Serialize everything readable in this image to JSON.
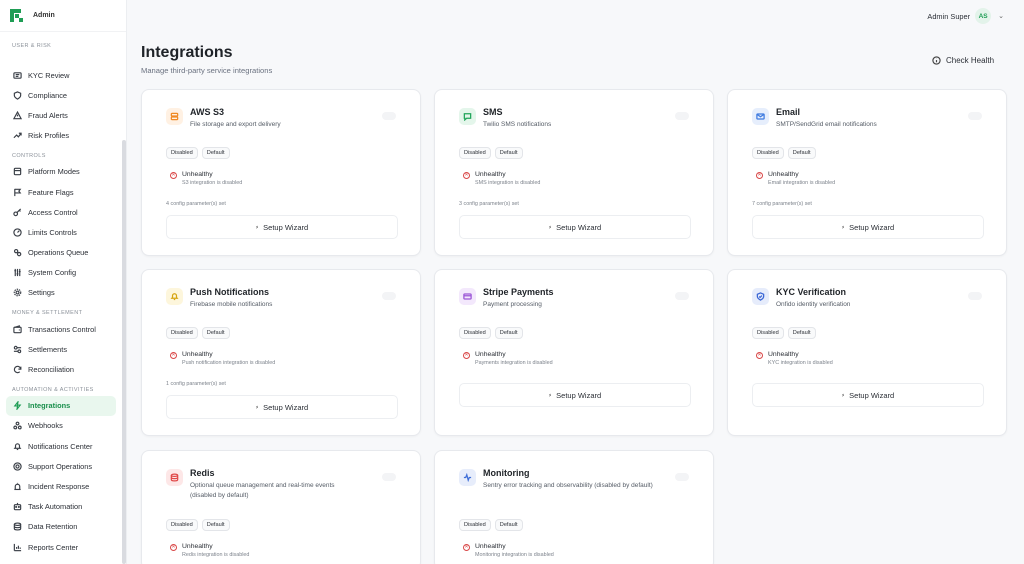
{
  "brand": {
    "name": "Admin"
  },
  "topbar": {
    "user_name": "Admin Super",
    "initials": "AS"
  },
  "sidebar": {
    "sections": [
      {
        "label": "USER & RISK",
        "items": [
          {
            "label": "KYC Review",
            "icon": "id-card-icon"
          },
          {
            "label": "Compliance",
            "icon": "shield-icon"
          },
          {
            "label": "Fraud Alerts",
            "icon": "alert-triangle-icon"
          },
          {
            "label": "Risk Profiles",
            "icon": "trending-up-icon"
          }
        ]
      },
      {
        "label": "CONTROLS",
        "items": [
          {
            "label": "Platform Modes",
            "icon": "layers-icon"
          },
          {
            "label": "Feature Flags",
            "icon": "flag-icon"
          },
          {
            "label": "Access Control",
            "icon": "key-icon"
          },
          {
            "label": "Limits Controls",
            "icon": "gauge-icon"
          },
          {
            "label": "Operations Queue",
            "icon": "cogs-icon"
          },
          {
            "label": "System Config",
            "icon": "sliders-icon"
          },
          {
            "label": "Settings",
            "icon": "gear-icon"
          }
        ]
      },
      {
        "label": "MONEY & SETTLEMENT",
        "items": [
          {
            "label": "Transactions Control",
            "icon": "wallet-icon"
          },
          {
            "label": "Settlements",
            "icon": "settings-2-icon"
          },
          {
            "label": "Reconciliation",
            "icon": "refresh-icon"
          }
        ]
      },
      {
        "label": "AUTOMATION & ACTIVITIES",
        "items": [
          {
            "label": "Integrations",
            "icon": "zap-icon",
            "active": true
          },
          {
            "label": "Webhooks",
            "icon": "webhook-icon"
          },
          {
            "label": "Notifications Center",
            "icon": "bell-icon"
          },
          {
            "label": "Support Operations",
            "icon": "life-buoy-icon"
          },
          {
            "label": "Incident Response",
            "icon": "siren-icon"
          },
          {
            "label": "Task Automation",
            "icon": "robot-icon"
          },
          {
            "label": "Data Retention",
            "icon": "database-icon"
          },
          {
            "label": "Reports Center",
            "icon": "bar-chart-icon"
          }
        ]
      }
    ]
  },
  "page": {
    "title": "Integrations",
    "subtitle": "Manage third-party service integrations",
    "check_health": "Check Health"
  },
  "cards": [
    {
      "title": "AWS S3",
      "desc": "File storage and export delivery",
      "badges": [
        "Disabled",
        "Default"
      ],
      "status": "Unhealthy",
      "message": "S3 integration is disabled",
      "config": "4 config parameter(s) set",
      "wizard": "Setup Wizard",
      "icon": "server-icon",
      "color": "#f08a24",
      "bg": "#fff1e3"
    },
    {
      "title": "SMS",
      "desc": "Twilio SMS notifications",
      "badges": [
        "Disabled",
        "Default"
      ],
      "status": "Unhealthy",
      "message": "SMS integration is disabled",
      "config": "3 config parameter(s) set",
      "wizard": "Setup Wizard",
      "icon": "message-icon",
      "color": "#22a55b",
      "bg": "#e4f6eb"
    },
    {
      "title": "Email",
      "desc": "SMTP/SendGrid email notifications",
      "badges": [
        "Disabled",
        "Default"
      ],
      "status": "Unhealthy",
      "message": "Email integration is disabled",
      "config": "7 config parameter(s) set",
      "wizard": "Setup Wizard",
      "icon": "mail-icon",
      "color": "#3f7be0",
      "bg": "#e6eefc"
    },
    {
      "title": "Push Notifications",
      "desc": "Firebase mobile notifications",
      "badges": [
        "Disabled",
        "Default"
      ],
      "status": "Unhealthy",
      "message": "Push notification integration is disabled",
      "config": "1 config parameter(s) set",
      "wizard": "Setup Wizard",
      "icon": "bell-icon",
      "color": "#d6a512",
      "bg": "#fdf6dc"
    },
    {
      "title": "Stripe Payments",
      "desc": "Payment processing",
      "badges": [
        "Disabled",
        "Default"
      ],
      "status": "Unhealthy",
      "message": "Payments integration is disabled",
      "config": "",
      "wizard": "Setup Wizard",
      "icon": "credit-card-icon",
      "color": "#9b55d6",
      "bg": "#f3e8fc"
    },
    {
      "title": "KYC Verification",
      "desc": "Onfido identity verification",
      "badges": [
        "Disabled",
        "Default"
      ],
      "status": "Unhealthy",
      "message": "KYC integration is disabled",
      "config": "",
      "wizard": "Setup Wizard",
      "icon": "shield-check-icon",
      "color": "#3b67d6",
      "bg": "#e6ecfb"
    },
    {
      "title": "Redis",
      "desc": "Optional queue management and real-time events (disabled by default)",
      "badges": [
        "Disabled",
        "Default"
      ],
      "status": "Unhealthy",
      "message": "Redis integration is disabled",
      "config": "",
      "wizard": "",
      "icon": "database-icon",
      "color": "#e04848",
      "bg": "#fde7e7"
    },
    {
      "title": "Monitoring",
      "desc": "Sentry error tracking and observability (disabled by default)",
      "badges": [
        "Disabled",
        "Default"
      ],
      "status": "Unhealthy",
      "message": "Monitoring integration is disabled",
      "config": "",
      "wizard": "",
      "icon": "activity-icon",
      "color": "#3f6fd8",
      "bg": "#e7edfb"
    }
  ]
}
